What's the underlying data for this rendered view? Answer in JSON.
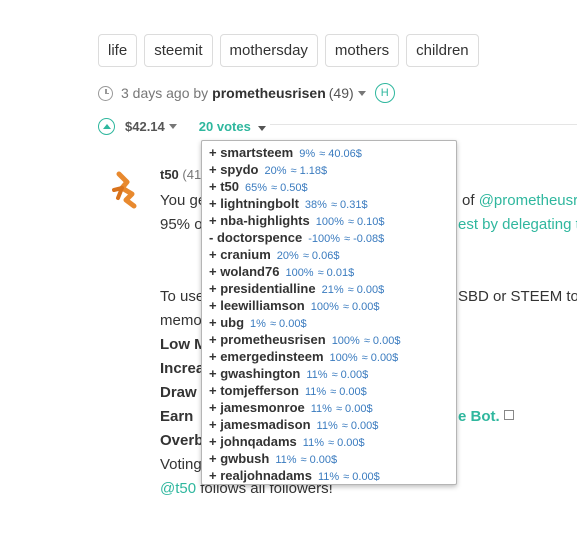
{
  "tags": [
    "life",
    "steemit",
    "mothersday",
    "mothers",
    "children"
  ],
  "post_meta": {
    "time": "3 days ago by",
    "author": "prometheusrisen",
    "reputation": "(49)",
    "badge": "H"
  },
  "vote_bar": {
    "payout": "$42.14",
    "votes": "20 votes"
  },
  "comment": {
    "author": "t50",
    "reputation": "(41",
    "lines": [
      {
        "pre": "You ge",
        "mid": "of ",
        "link": "@prometheusr"
      },
      {
        "pre": "95% o",
        "link": "est by delegating t"
      },
      {
        "pre": "To use",
        "mid": "SBD or STEEM to ",
        "link": "@"
      },
      {
        "pre": "memo"
      },
      {
        "bold": "Low M"
      },
      {
        "bold": "Increa"
      },
      {
        "bold": "Draw"
      },
      {
        "bold": "Earn",
        "link": "e Bot."
      },
      {
        "bold": "Overb"
      },
      {
        "pre": "Voting"
      },
      {
        "link": "@t50",
        "post": " follows all followers!"
      }
    ]
  },
  "voters": [
    {
      "sign": "+",
      "name": "smartsteem",
      "pct": "9%",
      "val": "≈ 40.06$"
    },
    {
      "sign": "+",
      "name": "spydo",
      "pct": "20%",
      "val": "≈ 1.18$"
    },
    {
      "sign": "+",
      "name": "t50",
      "pct": "65%",
      "val": "≈ 0.50$"
    },
    {
      "sign": "+",
      "name": "lightningbolt",
      "pct": "38%",
      "val": "≈ 0.31$"
    },
    {
      "sign": "+",
      "name": "nba-highlights",
      "pct": "100%",
      "val": "≈ 0.10$"
    },
    {
      "sign": "-",
      "name": "doctorspence",
      "pct": "-100%",
      "val": "≈ -0.08$"
    },
    {
      "sign": "+",
      "name": "cranium",
      "pct": "20%",
      "val": "≈ 0.06$"
    },
    {
      "sign": "+",
      "name": "woland76",
      "pct": "100%",
      "val": "≈ 0.01$"
    },
    {
      "sign": "+",
      "name": "presidentialline",
      "pct": "21%",
      "val": "≈ 0.00$"
    },
    {
      "sign": "+",
      "name": "leewilliamson",
      "pct": "100%",
      "val": "≈ 0.00$"
    },
    {
      "sign": "+",
      "name": "ubg",
      "pct": "1%",
      "val": "≈ 0.00$"
    },
    {
      "sign": "+",
      "name": "prometheusrisen",
      "pct": "100%",
      "val": "≈ 0.00$"
    },
    {
      "sign": "+",
      "name": "emergedinsteem",
      "pct": "100%",
      "val": "≈ 0.00$"
    },
    {
      "sign": "+",
      "name": "gwashington",
      "pct": "11%",
      "val": "≈ 0.00$"
    },
    {
      "sign": "+",
      "name": "tomjefferson",
      "pct": "11%",
      "val": "≈ 0.00$"
    },
    {
      "sign": "+",
      "name": "jamesmonroe",
      "pct": "11%",
      "val": "≈ 0.00$"
    },
    {
      "sign": "+",
      "name": "jamesmadison",
      "pct": "11%",
      "val": "≈ 0.00$"
    },
    {
      "sign": "+",
      "name": "johnqadams",
      "pct": "11%",
      "val": "≈ 0.00$"
    },
    {
      "sign": "+",
      "name": "gwbush",
      "pct": "11%",
      "val": "≈ 0.00$"
    },
    {
      "sign": "+",
      "name": "realjohnadams",
      "pct": "11%",
      "val": "≈ 0.00$"
    }
  ],
  "colors": {
    "accent": "#2fb79e",
    "value_blue": "#3a7bbf"
  }
}
